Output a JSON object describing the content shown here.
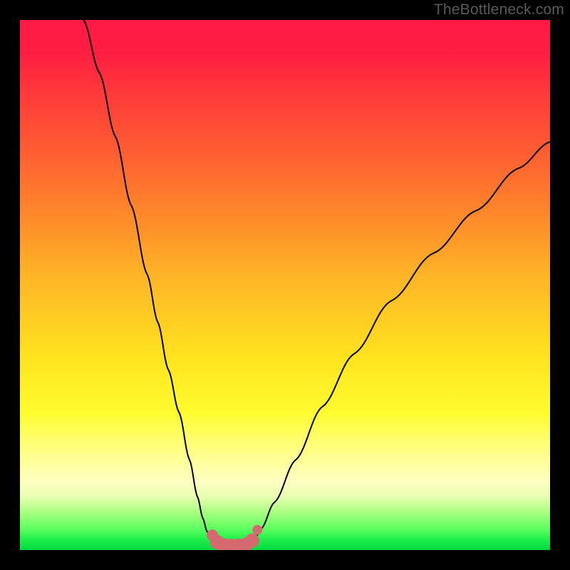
{
  "watermark": "TheBottleneck.com",
  "chart_data": {
    "type": "line",
    "title": "",
    "xlabel": "",
    "ylabel": "",
    "xlim": [
      0,
      100
    ],
    "ylim": [
      0,
      100
    ],
    "grid": false,
    "series": [
      {
        "name": "left-curve",
        "x": [
          12,
          15,
          18,
          21,
          24,
          26,
          28,
          30,
          32,
          33.5,
          34.5,
          35.3,
          36,
          36.6
        ],
        "y": [
          100,
          90,
          78,
          65,
          52,
          43,
          34,
          26,
          17,
          10,
          6,
          3.5,
          2.2,
          1.5
        ]
      },
      {
        "name": "right-curve",
        "x": [
          44,
          45.5,
          48,
          52,
          57,
          63,
          70,
          78,
          86,
          94,
          100
        ],
        "y": [
          1.5,
          4,
          9,
          17,
          27,
          37,
          47,
          56,
          64,
          72,
          77
        ]
      },
      {
        "name": "valley-markers",
        "x": [
          36.3,
          37.2,
          38.4,
          39.8,
          41.2,
          42.6,
          43.8,
          44.8
        ],
        "y": [
          2.8,
          1.5,
          0.9,
          0.8,
          0.8,
          1.0,
          1.8,
          3.8
        ]
      }
    ],
    "colors": {
      "curve": "#000000",
      "markers": "#d46a6f",
      "gradient_top": "#ff1a46",
      "gradient_mid": "#ffe41f",
      "gradient_bottom": "#06d93e"
    }
  }
}
